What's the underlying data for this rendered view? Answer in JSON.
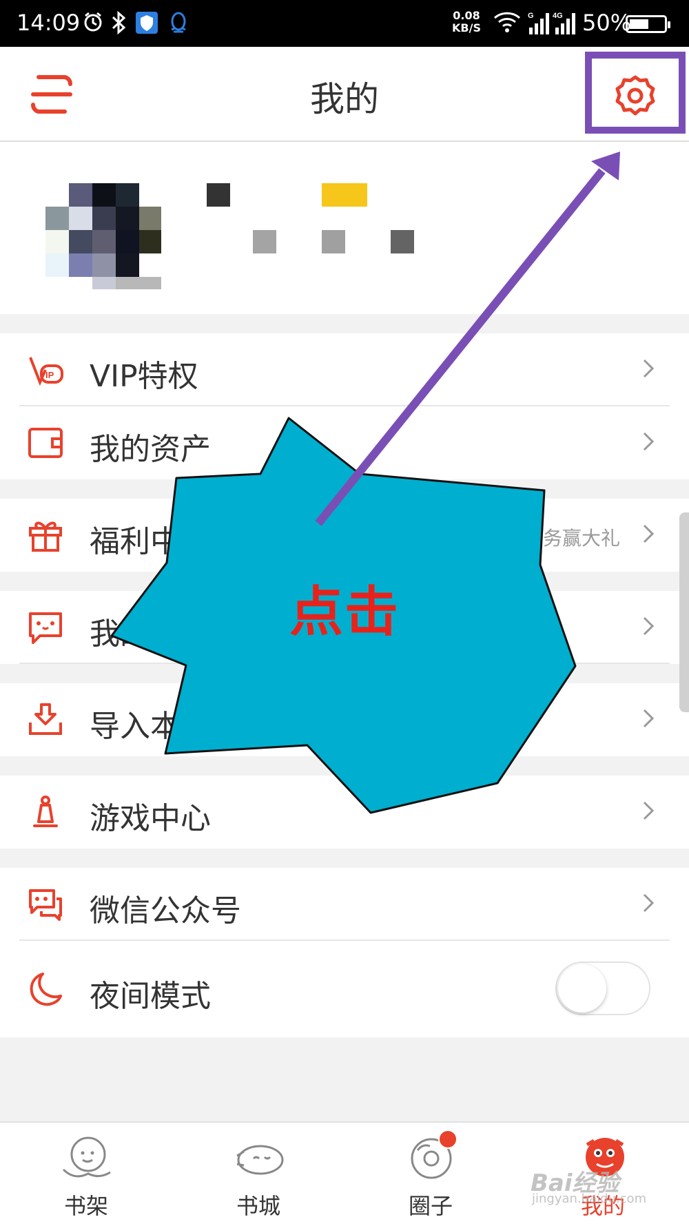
{
  "status_bar": {
    "time": "14:09",
    "speed": "0.08",
    "speed_unit": "KB/S",
    "net1": "G",
    "net2": "4G",
    "battery": "50%",
    "battery_level": 0.5
  },
  "header": {
    "title": "我的",
    "menu_icon": "menu-icon",
    "settings_icon": "gear-icon"
  },
  "menu": {
    "vip": {
      "label": "VIP特权"
    },
    "assets": {
      "label": "我的资产"
    },
    "welfare": {
      "label": "福利中心",
      "hint": "任务赢大礼"
    },
    "messages": {
      "label": "我的消息"
    },
    "import": {
      "label": "导入本地书"
    },
    "games": {
      "label": "游戏中心"
    },
    "wechat": {
      "label": "微信公众号"
    },
    "night": {
      "label": "夜间模式",
      "enabled": false
    }
  },
  "tabs": [
    {
      "label": "书架"
    },
    {
      "label": "书城"
    },
    {
      "label": "圈子"
    },
    {
      "label": "我的"
    }
  ],
  "annotation": {
    "callout_text": "点击"
  },
  "watermark": {
    "text": "Bai经验",
    "sub": "jingyan.baidu.com"
  },
  "colors": {
    "accent": "#e8412c",
    "callout_fill": "#00aecf",
    "arrow": "#7a4fb5"
  }
}
